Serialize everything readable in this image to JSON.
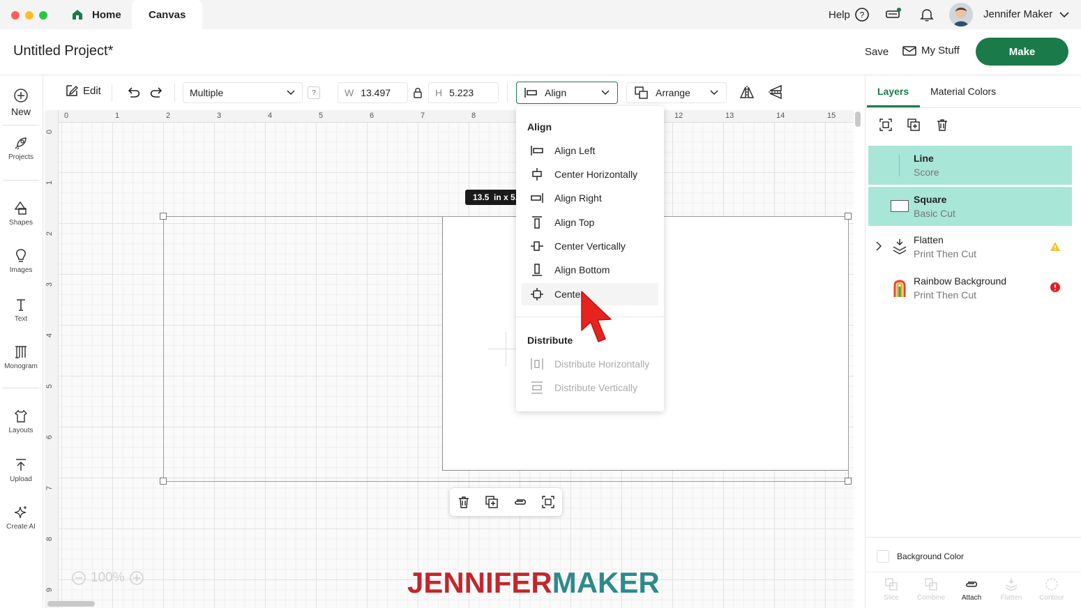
{
  "titlebar": {
    "tabs": [
      {
        "label": "Home"
      },
      {
        "label": "Canvas"
      }
    ],
    "help_label": "Help",
    "user_name": "Jennifer Maker"
  },
  "header": {
    "project_title": "Untitled Project*",
    "save_label": "Save",
    "mystuff_label": "My Stuff",
    "make_label": "Make"
  },
  "leftrail": {
    "items": [
      {
        "label": "New",
        "icon": "plus-circle-icon"
      },
      {
        "label": "Projects",
        "icon": "rocket-icon"
      },
      {
        "label": "Shapes",
        "icon": "shapes-icon"
      },
      {
        "label": "Images",
        "icon": "lightbulb-icon"
      },
      {
        "label": "Text",
        "icon": "text-icon"
      },
      {
        "label": "Monogram",
        "icon": "monogram-icon"
      },
      {
        "label": "Layouts",
        "icon": "shirt-icon"
      },
      {
        "label": "Upload",
        "icon": "upload-icon"
      },
      {
        "label": "Create AI",
        "icon": "sparkle-icon"
      }
    ]
  },
  "toolbar": {
    "edit_label": "Edit",
    "operation_value": "Multiple",
    "help_q": "?",
    "width_label": "W",
    "width_value": "13.497",
    "height_label": "H",
    "height_value": "5.223",
    "align_label": "Align",
    "arrange_label": "Arrange"
  },
  "ruler": {
    "top": [
      "0",
      "1",
      "2",
      "3",
      "4",
      "5",
      "6",
      "7",
      "8",
      "12",
      "13",
      "14",
      "15"
    ],
    "left": [
      "0",
      "1",
      "2",
      "3",
      "4",
      "5",
      "6",
      "7",
      "8",
      "9"
    ]
  },
  "canvas": {
    "size_tooltip": "13.5  in x 5.",
    "zoom": "100%",
    "watermark_a": "JENNIFER",
    "watermark_b": "MAKER",
    "watermark_colors": {
      "a": "#c0282d",
      "b": "#2e8a8a"
    }
  },
  "align_menu": {
    "align_heading": "Align",
    "items": [
      {
        "label": "Align Left",
        "icon": "align-left-icon"
      },
      {
        "label": "Center Horizontally",
        "icon": "center-horizontally-icon"
      },
      {
        "label": "Align Right",
        "icon": "align-right-icon"
      },
      {
        "label": "Align Top",
        "icon": "align-top-icon"
      },
      {
        "label": "Center Vertically",
        "icon": "center-vertically-icon"
      },
      {
        "label": "Align Bottom",
        "icon": "align-bottom-icon"
      },
      {
        "label": "Center",
        "icon": "center-icon"
      }
    ],
    "distribute_heading": "Distribute",
    "distribute_items": [
      {
        "label": "Distribute Horizontally",
        "icon": "distribute-horizontally-icon"
      },
      {
        "label": "Distribute Vertically",
        "icon": "distribute-vertically-icon"
      }
    ]
  },
  "rightpanel": {
    "tabs": [
      {
        "label": "Layers"
      },
      {
        "label": "Material Colors"
      }
    ],
    "layers": [
      {
        "title": "Line",
        "sub": "Score",
        "selected": true
      },
      {
        "title": "Square",
        "sub": "Basic Cut",
        "selected": true
      },
      {
        "title": "Flatten",
        "sub": "Print Then Cut",
        "selected": false,
        "status": "warning"
      },
      {
        "title": "Rainbow Background",
        "sub": "Print Then Cut",
        "selected": false,
        "status": "error"
      }
    ],
    "background_color_label": "Background Color",
    "bottom_tools": [
      {
        "label": "Slice",
        "enabled": false
      },
      {
        "label": "Combine",
        "enabled": false
      },
      {
        "label": "Attach",
        "enabled": true
      },
      {
        "label": "Flatten",
        "enabled": false
      },
      {
        "label": "Contour",
        "enabled": false
      }
    ]
  },
  "colors": {
    "accent_green": "#1b7a4a",
    "layer_selected": "#a8e6d8",
    "cursor_red": "#e8231f",
    "warning": "#f2c230",
    "error": "#e02020"
  }
}
